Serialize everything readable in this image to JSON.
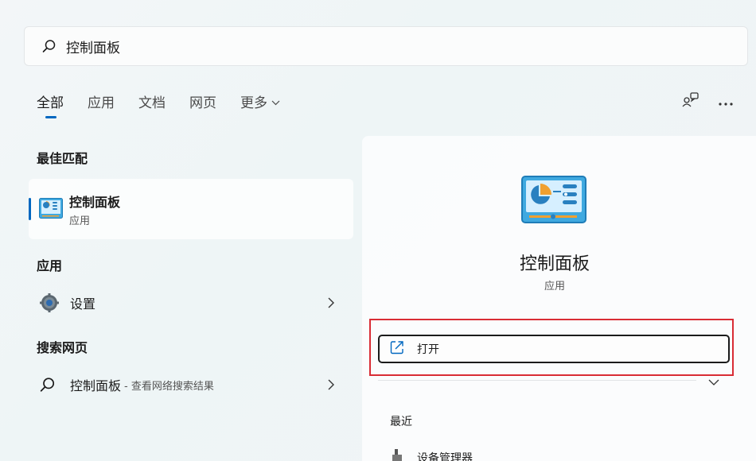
{
  "search": {
    "value": "控制面板"
  },
  "tabs": [
    {
      "label": "全部",
      "active": true
    },
    {
      "label": "应用"
    },
    {
      "label": "文档"
    },
    {
      "label": "网页"
    },
    {
      "label": "更多"
    }
  ],
  "sections": {
    "best_match": "最佳匹配",
    "apps": "应用",
    "web": "搜索网页"
  },
  "best_match": {
    "name": "控制面板",
    "type": "应用"
  },
  "apps_list": [
    {
      "label": "设置"
    }
  ],
  "web_list": [
    {
      "label": "控制面板",
      "hint": "- 查看网络搜索结果"
    }
  ],
  "detail": {
    "name": "控制面板",
    "type": "应用",
    "open_label": "打开",
    "recent_title": "最近",
    "recent_items": [
      {
        "label": "设备管理器"
      }
    ]
  },
  "colors": {
    "accent": "#0067c0",
    "highlight": "#d92c35"
  },
  "icons": [
    "search-icon",
    "chevron-down-icon",
    "feedback-icon",
    "more-icon",
    "control-panel-icon",
    "gear-icon",
    "chevron-right-icon",
    "open-external-icon",
    "device-manager-icon"
  ]
}
